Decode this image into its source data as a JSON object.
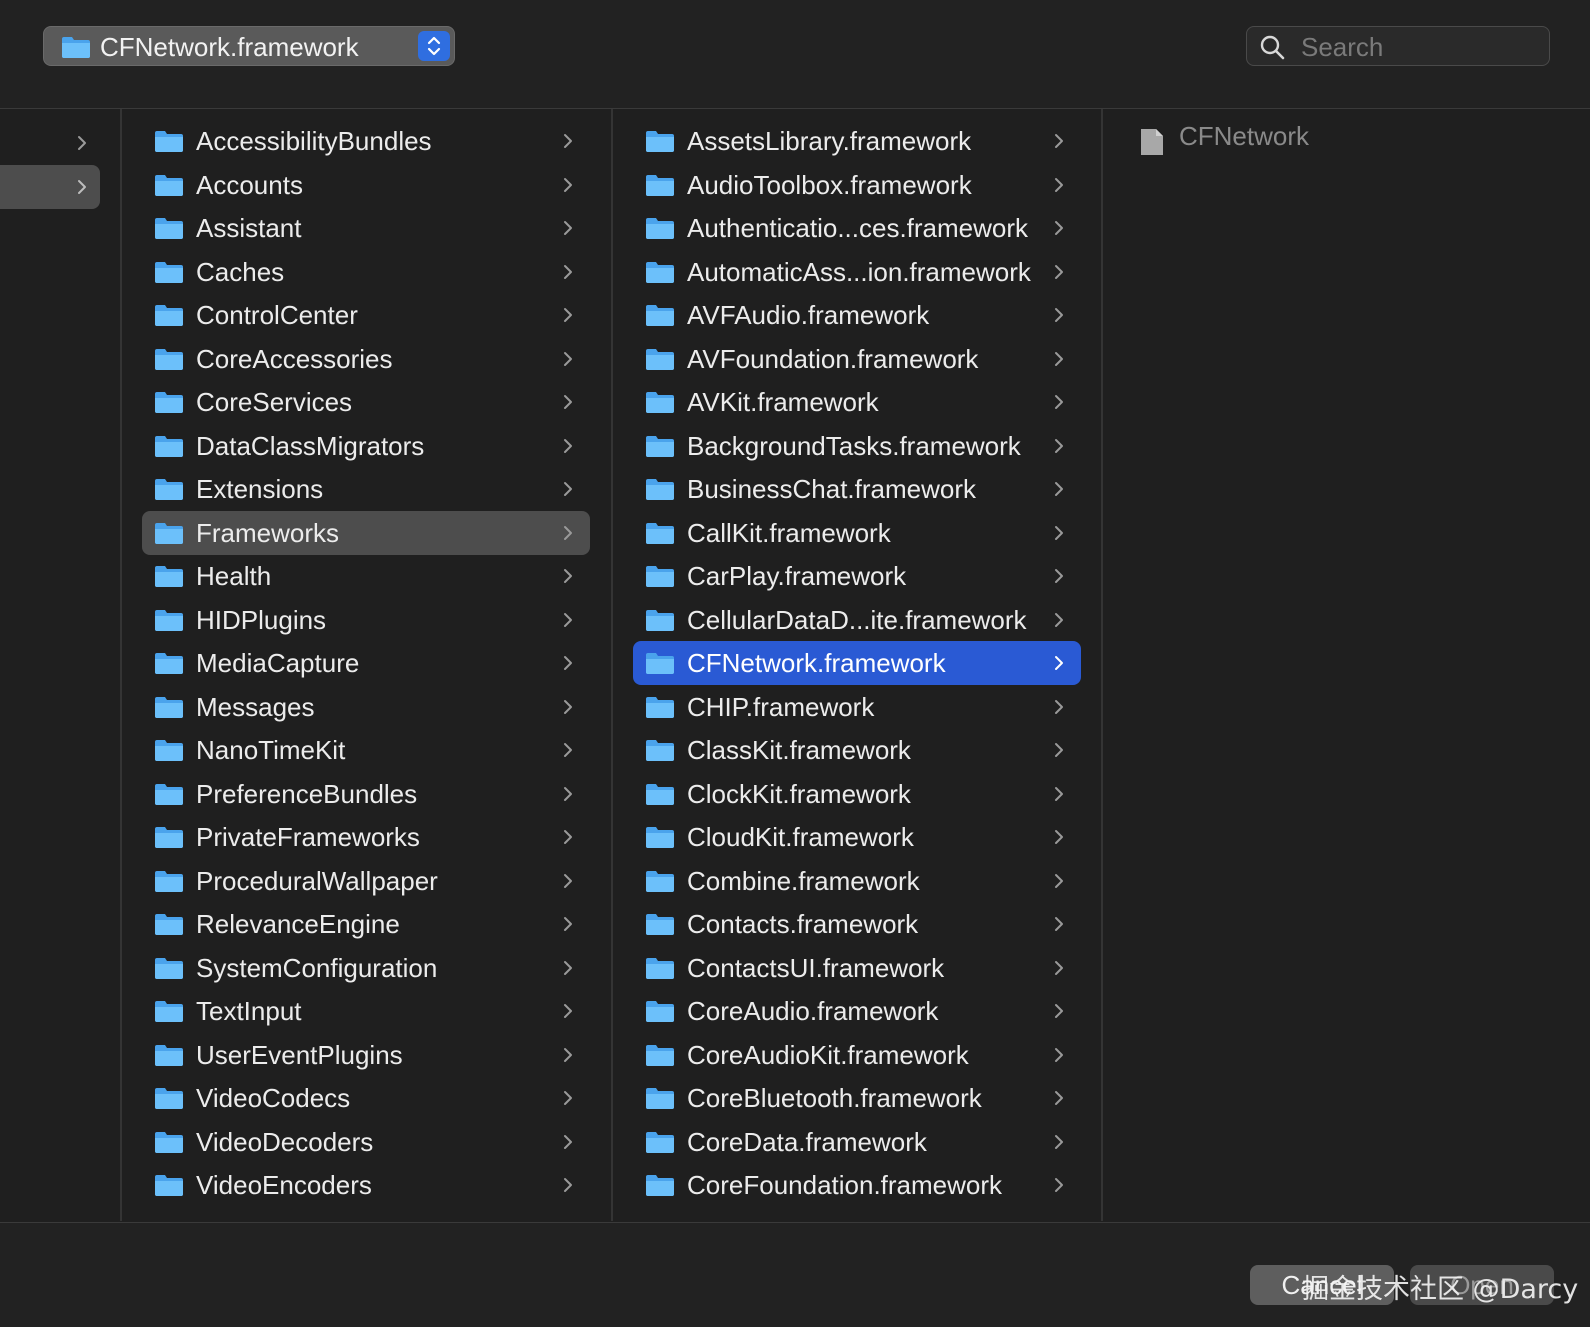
{
  "toolbar": {
    "path_popup_label": "CFNetwork.framework",
    "search_placeholder": "Search"
  },
  "colors": {
    "background": "#1f1f1f",
    "selection_blue": "#2a5ad4",
    "selection_gray": "#4d4d4d",
    "folder_blue": "#5ab0f0"
  },
  "column1": {
    "selected": "Frameworks",
    "items": [
      "AccessibilityBundles",
      "Accounts",
      "Assistant",
      "Caches",
      "ControlCenter",
      "CoreAccessories",
      "CoreServices",
      "DataClassMigrators",
      "Extensions",
      "Frameworks",
      "Health",
      "HIDPlugins",
      "MediaCapture",
      "Messages",
      "NanoTimeKit",
      "PreferenceBundles",
      "PrivateFrameworks",
      "ProceduralWallpaper",
      "RelevanceEngine",
      "SystemConfiguration",
      "TextInput",
      "UserEventPlugins",
      "VideoCodecs",
      "VideoDecoders",
      "VideoEncoders"
    ]
  },
  "column2": {
    "selected": "CFNetwork.framework",
    "items": [
      "AssetsLibrary.framework",
      "AudioToolbox.framework",
      "Authenticatio...ces.framework",
      "AutomaticAss...ion.framework",
      "AVFAudio.framework",
      "AVFoundation.framework",
      "AVKit.framework",
      "BackgroundTasks.framework",
      "BusinessChat.framework",
      "CallKit.framework",
      "CarPlay.framework",
      "CellularDataD...ite.framework",
      "CFNetwork.framework",
      "CHIP.framework",
      "ClassKit.framework",
      "ClockKit.framework",
      "CloudKit.framework",
      "Combine.framework",
      "Contacts.framework",
      "ContactsUI.framework",
      "CoreAudio.framework",
      "CoreAudioKit.framework",
      "CoreBluetooth.framework",
      "CoreData.framework",
      "CoreFoundation.framework"
    ]
  },
  "column3": {
    "file_name": "CFNetwork"
  },
  "footer": {
    "cancel_label": "Cancel",
    "open_label": "Open",
    "watermark": "掘金技术社区 @Darcy"
  },
  "icons": [
    "folder-icon",
    "chevron-right-icon",
    "search-icon",
    "updown-stepper-icon",
    "document-icon"
  ]
}
